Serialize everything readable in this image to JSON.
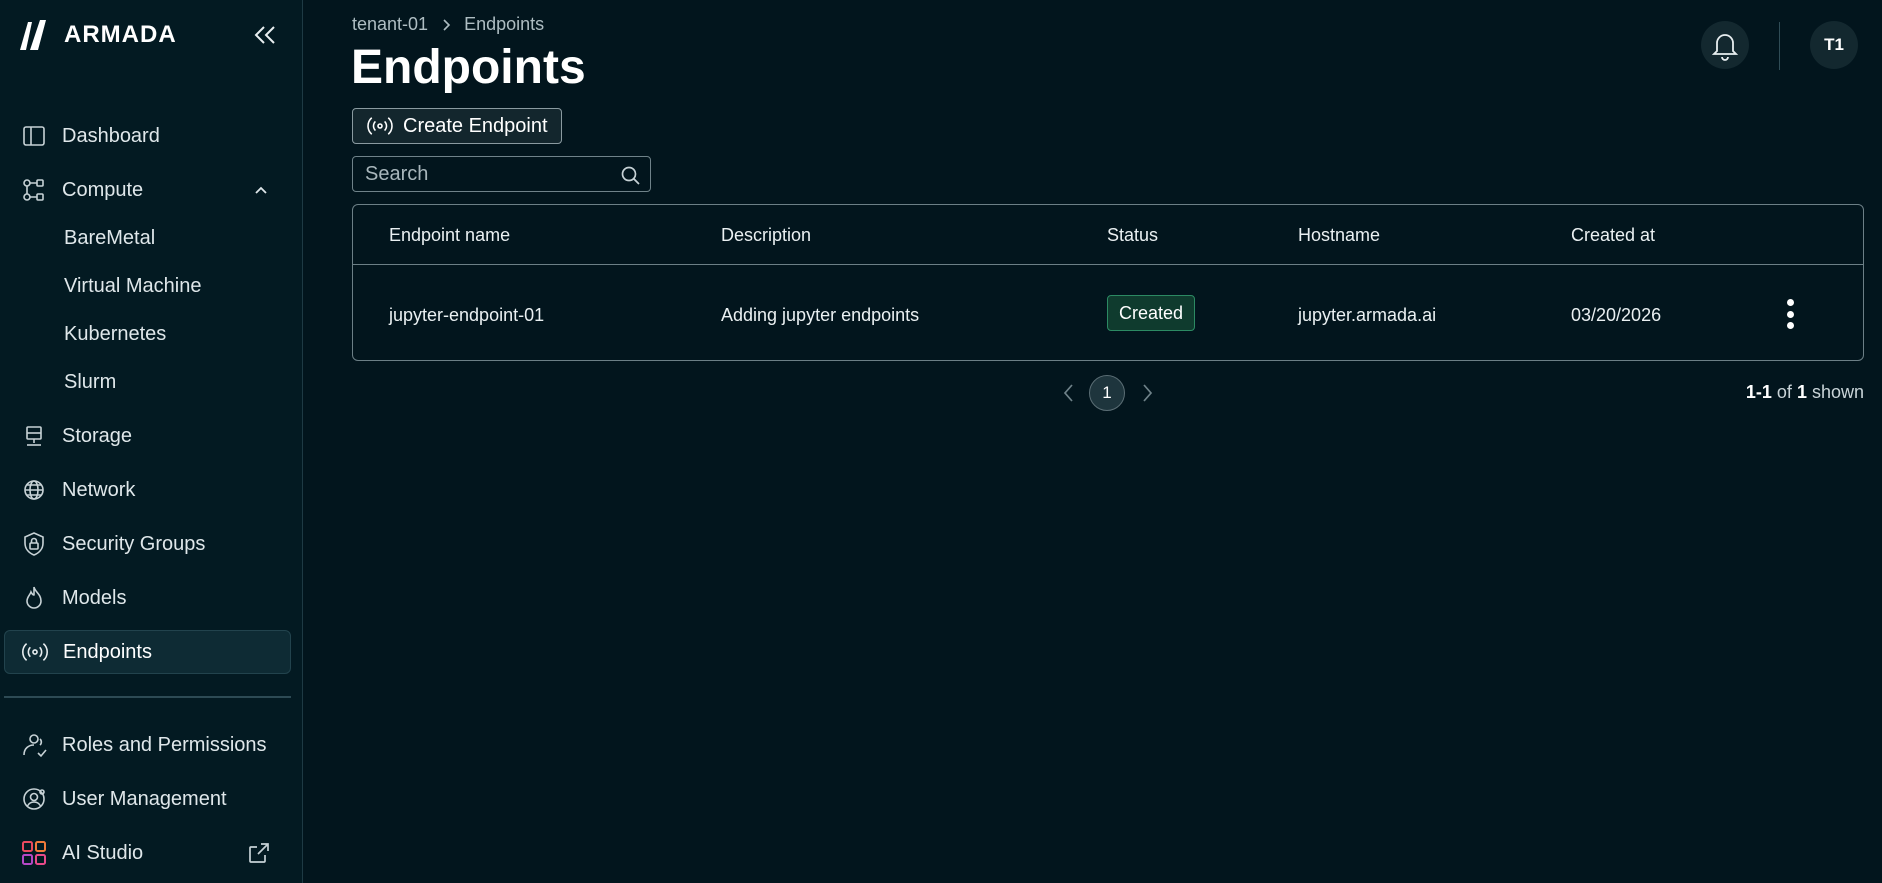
{
  "brand": {
    "name": "ARMADA"
  },
  "sidebar": {
    "items": [
      {
        "label": "Dashboard",
        "icon": "dashboard-icon"
      },
      {
        "label": "Compute",
        "icon": "compute-icon",
        "expanded": true,
        "children": [
          "BareMetal",
          "Virtual Machine",
          "Kubernetes",
          "Slurm"
        ]
      },
      {
        "label": "Storage",
        "icon": "storage-icon"
      },
      {
        "label": "Network",
        "icon": "globe-icon"
      },
      {
        "label": "Security Groups",
        "icon": "shield-lock-icon"
      },
      {
        "label": "Models",
        "icon": "flame-icon"
      },
      {
        "label": "Endpoints",
        "icon": "broadcast-icon",
        "active": true
      }
    ],
    "bottom": [
      {
        "label": "Roles and Permissions",
        "icon": "users-check-icon"
      },
      {
        "label": "User Management",
        "icon": "user-gear-icon"
      },
      {
        "label": "AI Studio",
        "icon": "grid-apps-icon",
        "external": true
      }
    ]
  },
  "breadcrumb": {
    "tenant": "tenant-01",
    "current": "Endpoints"
  },
  "page": {
    "title": "Endpoints"
  },
  "header": {
    "avatar_initials": "T1"
  },
  "toolbar": {
    "create_label": "Create Endpoint"
  },
  "search": {
    "placeholder": "Search",
    "value": ""
  },
  "table": {
    "columns": [
      "Endpoint name",
      "Description",
      "Status",
      "Hostname",
      "Created at"
    ],
    "rows": [
      {
        "name": "jupyter-endpoint-01",
        "description": "Adding jupyter endpoints",
        "status": "Created",
        "hostname": "jupyter.armada.ai",
        "created_at": "03/20/2026"
      }
    ]
  },
  "pagination": {
    "current_page": "1",
    "range": "1-1",
    "of_label": "of",
    "total": "1",
    "shown_label": "shown"
  },
  "colors": {
    "background": "#02151d",
    "sidebar": "#031a22",
    "status_created_bg": "#0f3b2e",
    "status_created_border": "#2c8a63"
  }
}
